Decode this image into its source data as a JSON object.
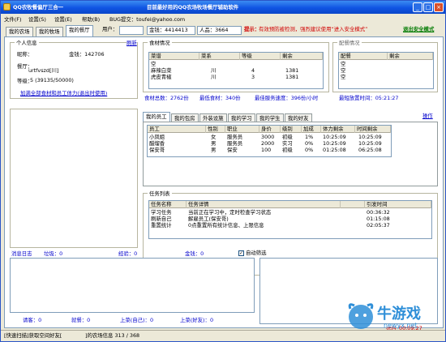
{
  "window": {
    "app_title": "QQ农牧餐偏厅三合一",
    "headline": "目前最好用的QQ农场牧场餐厅辅助软件"
  },
  "menu": [
    "文件(F)",
    "设置(S)",
    "设置(E)",
    "帮助(B)",
    "BUG提交：toufei@yahoo.com"
  ],
  "tabs": [
    "我的农场",
    "我的牧场",
    "我的餐厅"
  ],
  "infobar": {
    "user_label": "用户：",
    "gold_label": "金钱：4414413",
    "popularity_label": "人品：3664",
    "tip_label": "提示：",
    "tip_text": "有效预防被检测，强烈建议使用“进入安全模式”",
    "exit_safe": "退出安全模式"
  },
  "personal": {
    "title": "个人信息",
    "refresh": "刷新",
    "nickname_label": "昵称：",
    "gold_label": "金钱：142706",
    "restaurant_label": "餐厅：",
    "restaurant_value": "urtfvszd[川]",
    "level_label": "等级：",
    "level_value": "5 (39135/50000)",
    "buy_link": "加满全部食材和员工体力(退出时使用)"
  },
  "food": {
    "title": "食材情况",
    "columns": [
      "菜谱",
      "菜系",
      "等级",
      "剩余"
    ],
    "rows": [
      {
        "dish": "空",
        "cuisine": "",
        "level": "",
        "remain": ""
      },
      {
        "dish": "麻辣白菜",
        "cuisine": "川",
        "level": "4",
        "remain": "1381"
      },
      {
        "dish": "虎皮青椒",
        "cuisine": "川",
        "level": "3",
        "remain": "1381"
      }
    ]
  },
  "stove": {
    "title": "配餐情况",
    "columns": [
      "配餐",
      "剩余"
    ],
    "rows": [
      "空",
      "空",
      "空"
    ]
  },
  "stats": {
    "food_total": "食材总数：2762份",
    "min_food": "最低食材：340份",
    "max_speed": "最佳服务速度：396份/小时",
    "min_time": "最短放置时间：05:21:27"
  },
  "staff_tabs": [
    "我的员工",
    "我的包房",
    "外装设施",
    "我的学习",
    "我的学生",
    "我的好友"
  ],
  "staff_action": "操作",
  "staff": {
    "columns": [
      "员工",
      "性别",
      "职业",
      "身价",
      "级别",
      "加成",
      "体力剩余",
      "时间剩余"
    ],
    "rows": [
      {
        "name": "小凤姐",
        "sex": "女",
        "job": "服务员",
        "price": "3000",
        "level": "初级",
        "bonus": "1%",
        "stamina": "10:25:09",
        "time": "10:25:09"
      },
      {
        "name": "醋熘香",
        "sex": "男",
        "job": "服务员",
        "price": "2000",
        "level": "实习",
        "bonus": "0%",
        "stamina": "10:25:09",
        "time": "10:25:09"
      },
      {
        "name": "保安哥",
        "sex": "男",
        "job": "保安",
        "price": "100",
        "level": "初级",
        "bonus": "0%",
        "stamina": "01:25:08",
        "time": "06:25:08"
      }
    ]
  },
  "tasks": {
    "title": "任务列表",
    "columns": [
      "任务名称",
      "任务详情",
      "",
      "引发时间"
    ],
    "rows": [
      {
        "name": "学习任务",
        "detail": "当前正在学习中，定时检查学习状态",
        "time": "00:36:32"
      },
      {
        "name": "刷新自己",
        "detail": "解雇员工(保安哥)",
        "time": "01:15:08"
      },
      {
        "name": "重置统计",
        "detail": "0点重置所有统计信息、上限信息",
        "time": "02:05:37"
      }
    ]
  },
  "log": {
    "title": "消息日志",
    "garbage_label": "垃圾：0",
    "exp_label": "经验：0",
    "gold_label": "金钱：0",
    "auto_filter": "自动筛选",
    "auto_filter_checked": true
  },
  "counters": {
    "guest": "请客：0",
    "meal": "就餐：0",
    "table_self": "上菜(自己)：0",
    "table_friend": "上菜(好友)：0",
    "running_label": "运行",
    "running_time": "00:09:27"
  },
  "statusbar": {
    "left": "[快速扫描]获取空间好友[",
    "right": "]的农场信息 313 / 368"
  },
  "watermark": {
    "main": "牛游戏",
    "sub": "newyx.net"
  }
}
